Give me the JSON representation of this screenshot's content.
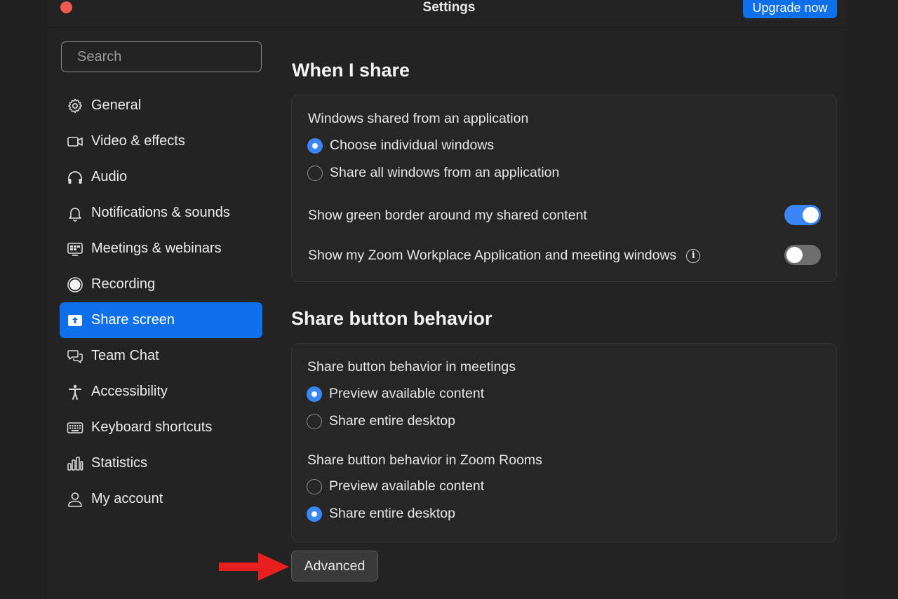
{
  "window": {
    "title": "Settings",
    "upgrade_label": "Upgrade now"
  },
  "search": {
    "placeholder": "Search",
    "icon": "search-icon"
  },
  "sidebar": {
    "items": [
      {
        "label": "General",
        "icon": "gear-icon"
      },
      {
        "label": "Video & effects",
        "icon": "video-camera-icon"
      },
      {
        "label": "Audio",
        "icon": "headphones-icon"
      },
      {
        "label": "Notifications & sounds",
        "icon": "bell-icon"
      },
      {
        "label": "Meetings & webinars",
        "icon": "meetings-icon"
      },
      {
        "label": "Recording",
        "icon": "record-icon"
      },
      {
        "label": "Share screen",
        "icon": "share-screen-icon",
        "active": true
      },
      {
        "label": "Team Chat",
        "icon": "chat-bubbles-icon"
      },
      {
        "label": "Accessibility",
        "icon": "accessibility-icon"
      },
      {
        "label": "Keyboard shortcuts",
        "icon": "keyboard-icon"
      },
      {
        "label": "Statistics",
        "icon": "bar-chart-icon"
      },
      {
        "label": "My account",
        "icon": "user-icon"
      }
    ]
  },
  "when_i_share": {
    "heading": "When I share",
    "windows_label": "Windows shared from an application",
    "options": [
      {
        "label": "Choose individual windows",
        "selected": true
      },
      {
        "label": "Share all windows from an application",
        "selected": false
      }
    ],
    "green_border_label": "Show green border around my shared content",
    "green_border_on": true,
    "zoom_windows_label": "Show my Zoom Workplace Application and meeting windows",
    "zoom_windows_on": false
  },
  "share_button_behavior": {
    "heading": "Share button behavior",
    "meetings_label": "Share button behavior in meetings",
    "meetings_options": [
      {
        "label": "Preview available content",
        "selected": true
      },
      {
        "label": "Share entire desktop",
        "selected": false
      }
    ],
    "rooms_label": "Share button behavior in Zoom Rooms",
    "rooms_options": [
      {
        "label": "Preview available content",
        "selected": false
      },
      {
        "label": "Share entire desktop",
        "selected": true
      }
    ]
  },
  "advanced_label": "Advanced",
  "colors": {
    "accent": "#0e71eb",
    "toggle_on": "#3a86f7",
    "close": "#ee5a52",
    "arrow": "#e8201d"
  }
}
